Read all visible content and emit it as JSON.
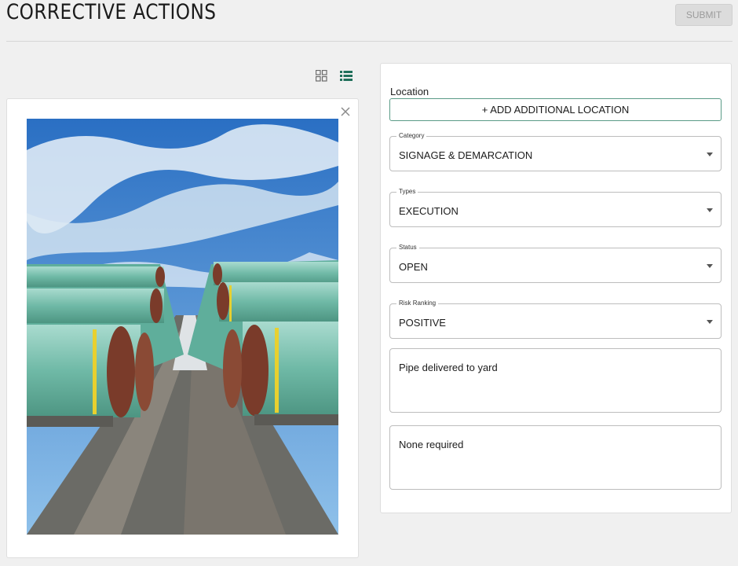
{
  "header": {
    "title": "CORRECTIVE ACTIONS",
    "submit_label": "SUBMIT"
  },
  "view": {
    "grid_icon": "grid-icon",
    "list_icon": "list-icon",
    "accent_color": "#1f6f5a"
  },
  "photo": {
    "close_icon": "close-icon"
  },
  "form": {
    "location_label": "Location",
    "add_location_label": "+ ADD ADDITIONAL LOCATION",
    "category": {
      "label": "Category",
      "value": "SIGNAGE & DEMARCATION"
    },
    "types": {
      "label": "Types",
      "value": "EXECUTION"
    },
    "status": {
      "label": "Status",
      "value": "OPEN"
    },
    "risk": {
      "label": "Risk Ranking",
      "value": "POSITIVE"
    },
    "description": "Pipe delivered to yard",
    "action": "None required"
  }
}
